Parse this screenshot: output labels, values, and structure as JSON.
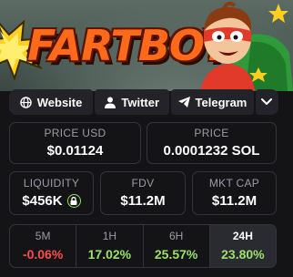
{
  "banner": {
    "logo_text": "FARTBOY",
    "colors": {
      "logo": "#ff6a1a",
      "burst": "#ffcf1f"
    }
  },
  "links": {
    "website": {
      "label": "Website",
      "icon": "globe-icon"
    },
    "twitter": {
      "label": "Twitter",
      "icon": "user-icon"
    },
    "telegram": {
      "label": "Telegram",
      "icon": "send-icon"
    },
    "more": {
      "icon": "chevron-down-icon"
    }
  },
  "price_usd": {
    "label": "PRICE USD",
    "value": "$0.01124"
  },
  "price_sol": {
    "label": "PRICE",
    "value": "0.0001232 SOL"
  },
  "liquidity": {
    "label": "LIQUIDITY",
    "value": "$456K",
    "icon": "lock-icon"
  },
  "fdv": {
    "label": "FDV",
    "value": "$11.2M"
  },
  "mkt_cap": {
    "label": "MKT CAP",
    "value": "$11.2M"
  },
  "changes": [
    {
      "label": "5M",
      "value": "-0.06%",
      "color": "#ff4d4d"
    },
    {
      "label": "1H",
      "value": "17.02%",
      "color": "#9be16b"
    },
    {
      "label": "6H",
      "value": "25.57%",
      "color": "#9be16b"
    },
    {
      "label": "24H",
      "value": "23.80%",
      "color": "#9be16b",
      "active": true
    }
  ]
}
